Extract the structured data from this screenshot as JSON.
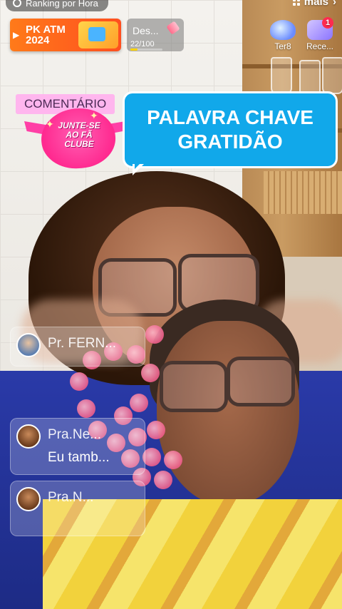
{
  "top": {
    "ranking_label": "Ranking por Hora",
    "more_label": "mais"
  },
  "pk_banner": {
    "title_line1": "PK ATM",
    "title_line2": "2024"
  },
  "progress_card": {
    "label": "Des...",
    "progress_text": "22/100",
    "progress": 0.22
  },
  "side_buttons": [
    {
      "label": "Ter8",
      "icon": "crystal-icon"
    },
    {
      "label": "Rece...",
      "icon": "gift-icon",
      "badge": "1"
    }
  ],
  "comment_tag": "COMENTÁRIO",
  "fan_club": {
    "line1": "JUNTE-SE",
    "line2": "AO FÃ",
    "line3": "CLUBE"
  },
  "caption": {
    "line1": "PALAVRA CHAVE",
    "line2": "GRATIDÃO"
  },
  "chat": [
    {
      "user": "Pr. FERN...",
      "message": ""
    },
    {
      "user": "Pra.Ne...",
      "message": "Eu tamb..."
    },
    {
      "user": "Pra.N...",
      "message": ""
    }
  ],
  "colors": {
    "caption_bg": "#11a8ea",
    "pk_orange": "#ff5a1f",
    "fan_pink": "#ff2a90"
  }
}
